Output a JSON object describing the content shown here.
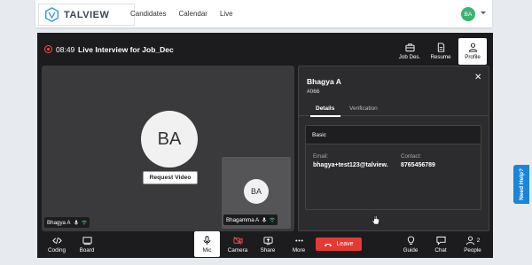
{
  "header": {
    "logo_text": "TALVIEW",
    "nav": [
      "Candidates",
      "Calendar",
      "Live"
    ],
    "user_initials": "BA"
  },
  "meeting": {
    "timer": "08:49",
    "title": "Live Interview for Job_Dec",
    "top_actions": [
      {
        "label": "Job Des.",
        "icon": "briefcase-icon"
      },
      {
        "label": "Resume",
        "icon": "document-icon"
      },
      {
        "label": "Profile",
        "icon": "person-icon",
        "active": true
      }
    ]
  },
  "main_tile": {
    "initials": "BA",
    "request_video_label": "Request Video",
    "participant_name": "Bhagya A"
  },
  "small_tile": {
    "initials": "BA",
    "participant_name": "Bhagamma A"
  },
  "profile_panel": {
    "name": "Bhagya A",
    "id": "#066",
    "tabs": [
      {
        "label": "Details",
        "active": true
      },
      {
        "label": "Verification",
        "active": false
      }
    ],
    "section_title": "Basic",
    "email_label": "Email:",
    "email_value": "bhagya+test123@talview.",
    "contact_label": "Contact:",
    "contact_value": "8765456789"
  },
  "toolbar": {
    "coding": "Coding",
    "board": "Board",
    "mic": "Mic",
    "camera": "Camera",
    "share": "Share",
    "more": "More",
    "leave": "Leave",
    "guide": "Guide",
    "chat": "Chat",
    "people": "People",
    "people_count": "2"
  },
  "help_tab": "Need Help?",
  "colors": {
    "accent_green": "#3cb371",
    "leave_red": "#e53935",
    "help_blue": "#1a86d8",
    "meeting_bg": "#1c1c1e"
  }
}
